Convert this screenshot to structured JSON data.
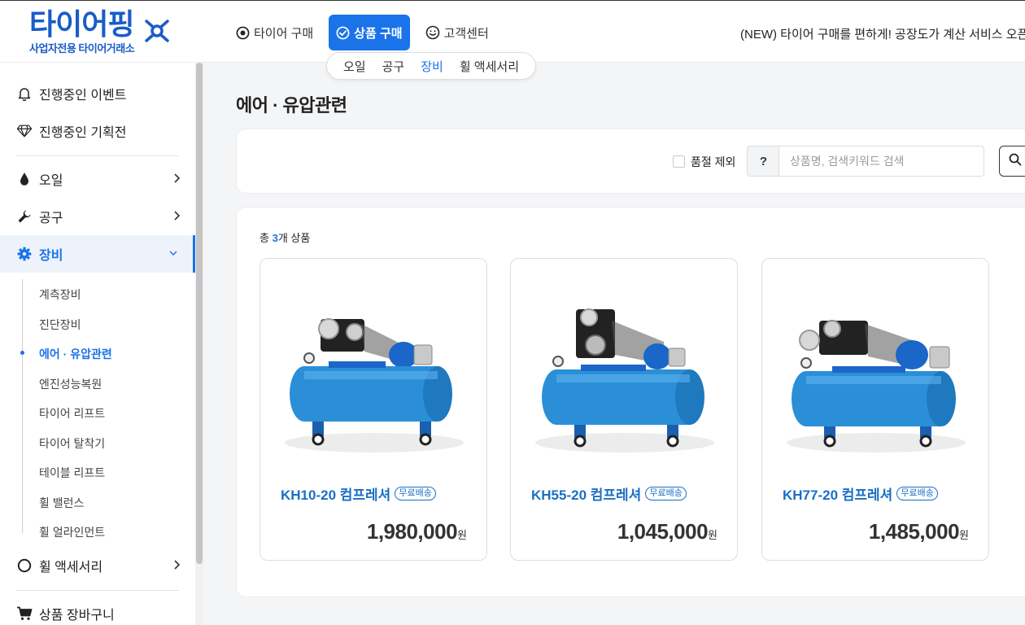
{
  "header": {
    "logo_main": "타이어핑",
    "logo_sub": "사업자전용 타이어거래소",
    "nav": [
      {
        "label": "타이어 구매",
        "icon": "target-icon"
      },
      {
        "label": "상품 구매",
        "icon": "check-circle-icon",
        "active": true
      },
      {
        "label": "고객센터",
        "icon": "smile-icon"
      }
    ],
    "notice": "(NEW) 타이어 구매를 편하게! 공장도가 계산 서비스 오픈!",
    "subnav": [
      "오일",
      "공구",
      "장비",
      "휠 액세서리"
    ],
    "subnav_active": "장비"
  },
  "sidebar": {
    "top_items": [
      "진행중인 이벤트",
      "진행중인 기획전"
    ],
    "categories": [
      {
        "label": "오일",
        "icon": "oil-drop-icon"
      },
      {
        "label": "공구",
        "icon": "wrench-icon"
      },
      {
        "label": "장비",
        "icon": "gear-icon",
        "active": true
      }
    ],
    "sub_items": [
      "계측장비",
      "진단장비",
      "에어 · 유압관련",
      "엔진성능복원",
      "타이어 리프트",
      "타이어 탈착기",
      "테이블 리프트",
      "휠 밸런스",
      "휠 얼라인먼트"
    ],
    "sub_active": "에어 · 유압관련",
    "after": {
      "label": "휠 액세서리",
      "icon": "circle-icon"
    },
    "cart": {
      "label": "상품 장바구니",
      "icon": "cart-icon"
    }
  },
  "main": {
    "title": "에어 · 유압관련",
    "exclude_soldout": "품절 제외",
    "help_label": "?",
    "search_placeholder": "상품명, 검색키워드 검색",
    "total_prefix": "총 ",
    "total_count": "3",
    "total_suffix": "개 상품",
    "products": [
      {
        "name": "KH10-20 컴프레셔",
        "badge": "무료배송",
        "price": "1,980,000",
        "unit": "원"
      },
      {
        "name": "KH55-20 컴프레셔",
        "badge": "무료배송",
        "price": "1,045,000",
        "unit": "원"
      },
      {
        "name": "KH77-20 컴프레셔",
        "badge": "무료배송",
        "price": "1,485,000",
        "unit": "원"
      }
    ]
  },
  "colors": {
    "accent": "#1a73e8",
    "brand": "#1a5cc8",
    "product_name": "#1a6fc4"
  }
}
